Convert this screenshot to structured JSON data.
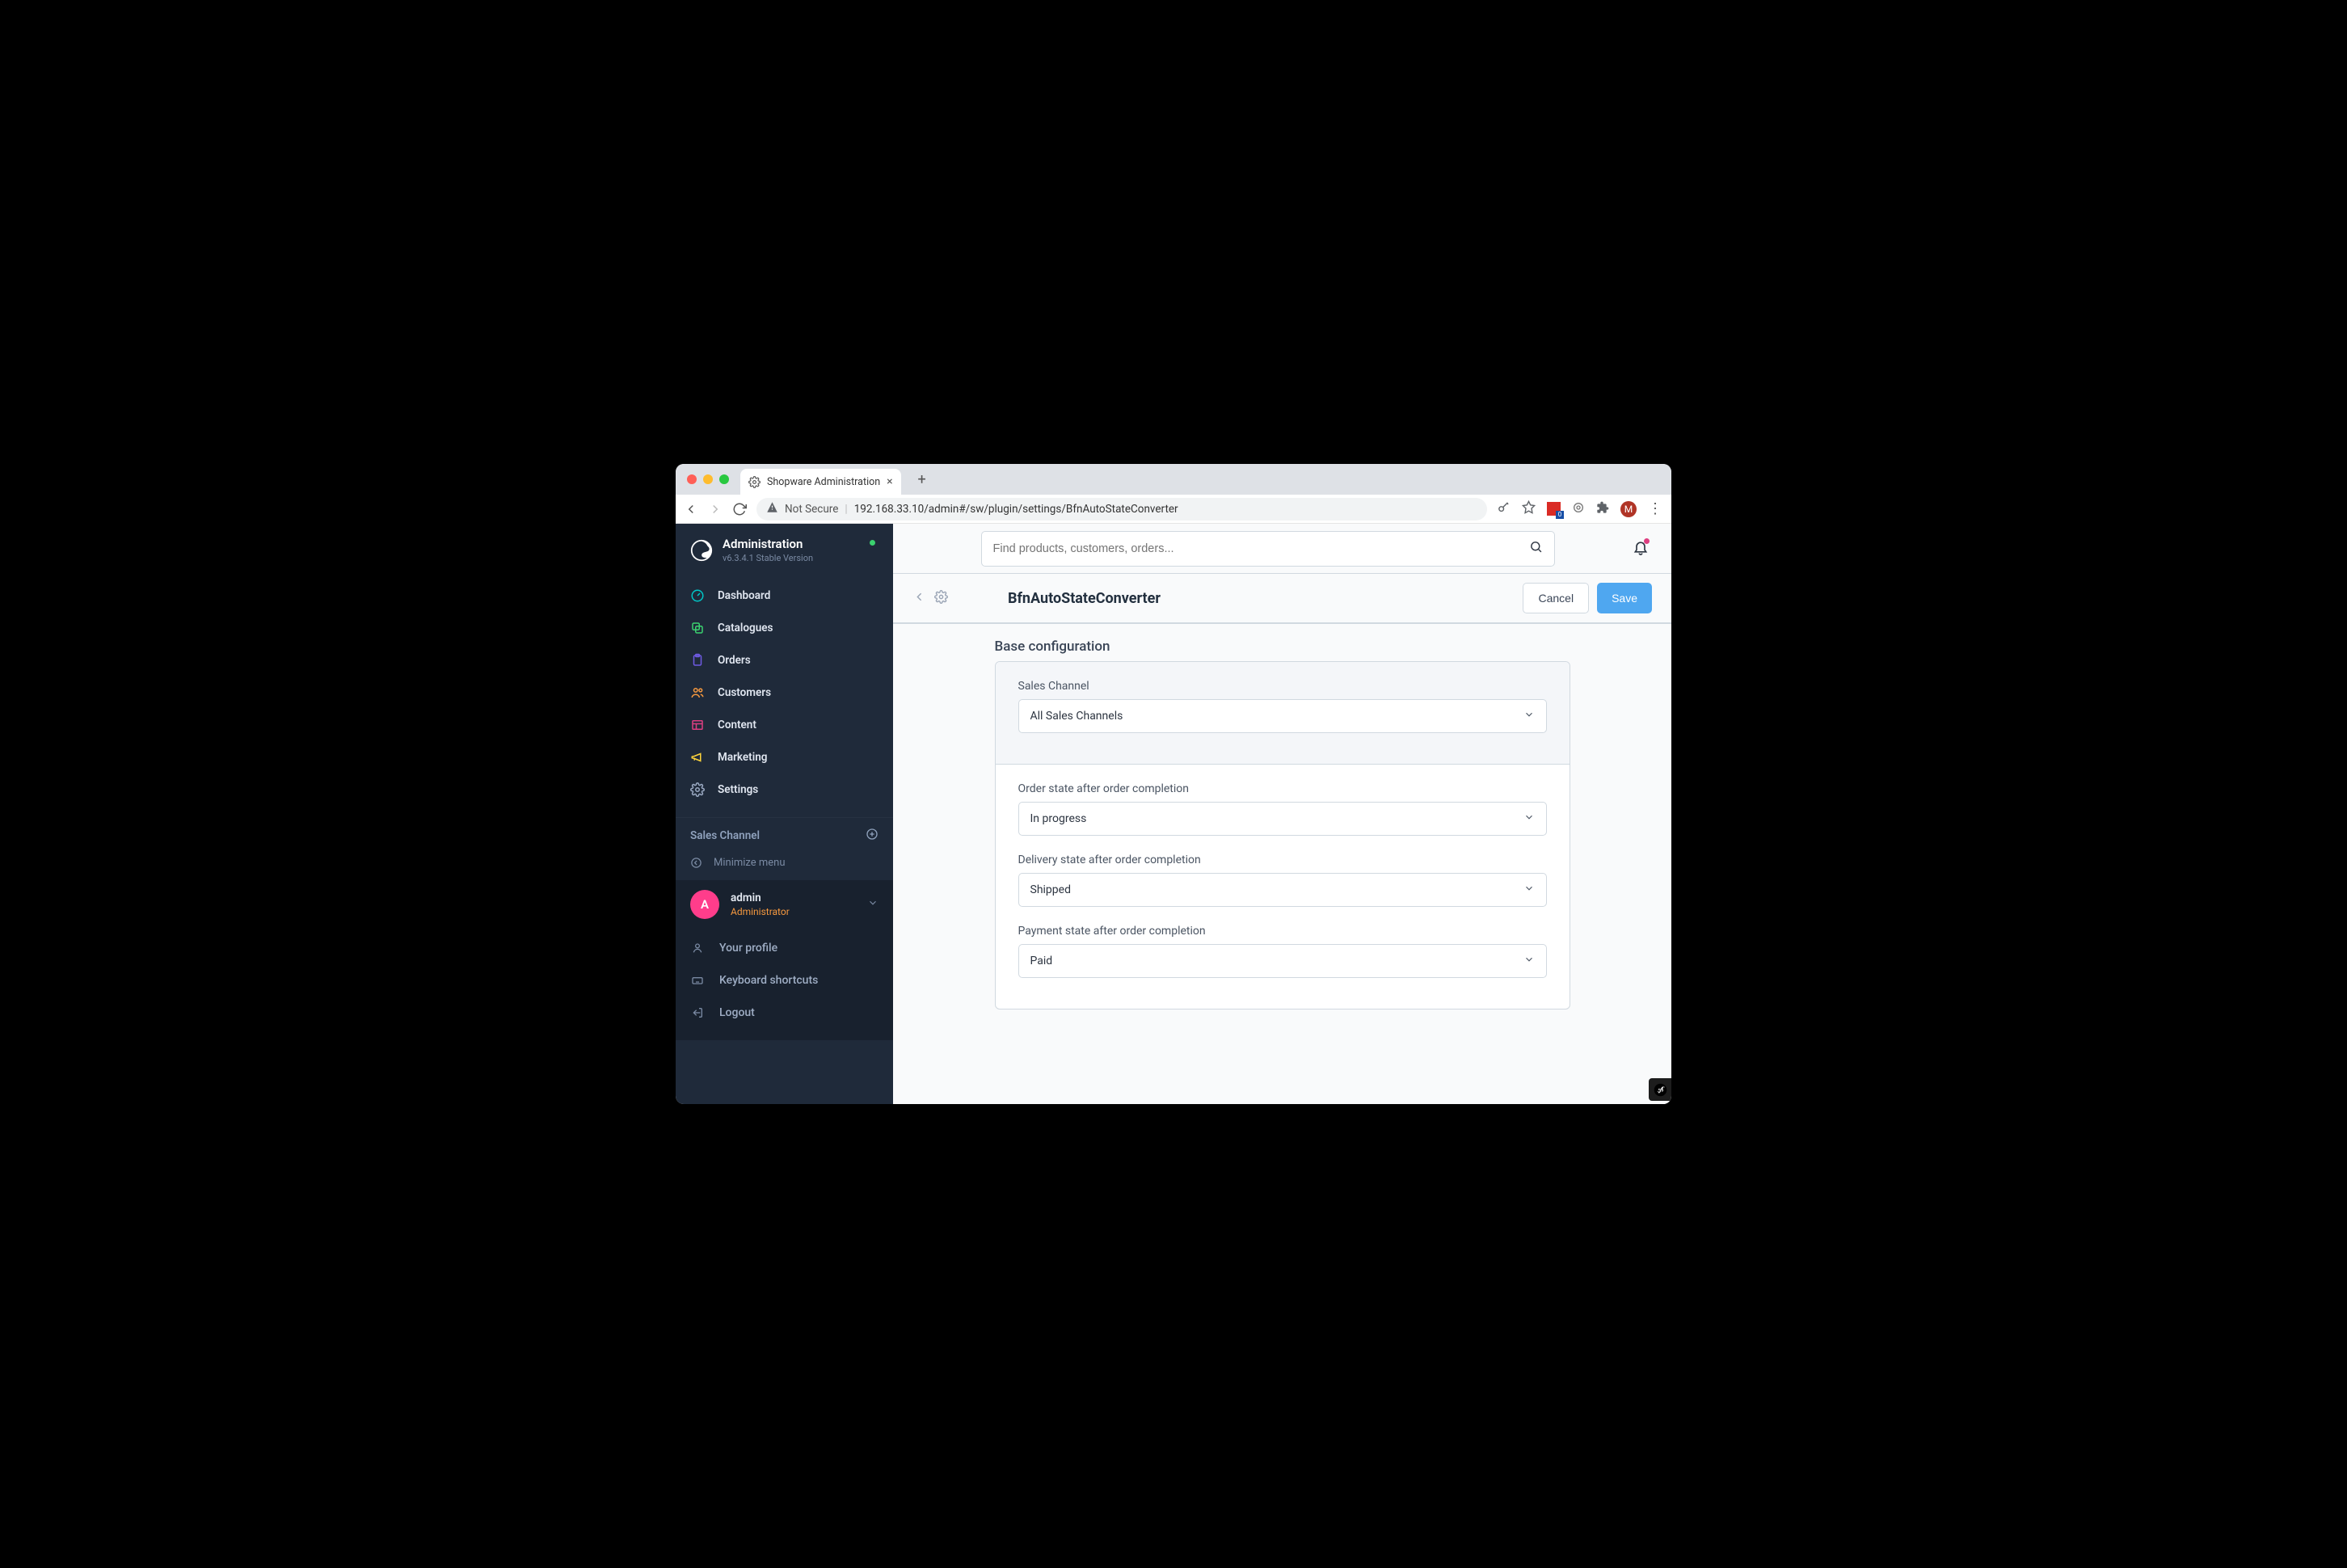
{
  "browser": {
    "tab_title": "Shopware Administration",
    "not_secure": "Not Secure",
    "url": "192.168.33.10/admin#/sw/plugin/settings/BfnAutoStateConverter",
    "avatar_letter": "M"
  },
  "sidebar": {
    "title": "Administration",
    "version": "v6.3.4.1 Stable Version",
    "nav": [
      {
        "label": "Dashboard"
      },
      {
        "label": "Catalogues"
      },
      {
        "label": "Orders"
      },
      {
        "label": "Customers"
      },
      {
        "label": "Content"
      },
      {
        "label": "Marketing"
      },
      {
        "label": "Settings"
      }
    ],
    "sales_channel_label": "Sales Channel",
    "minimize_label": "Minimize menu",
    "user": {
      "avatar_letter": "A",
      "name": "admin",
      "role": "Administrator"
    },
    "bottom": [
      {
        "label": "Your profile"
      },
      {
        "label": "Keyboard shortcuts"
      },
      {
        "label": "Logout"
      }
    ]
  },
  "main": {
    "search_placeholder": "Find products, customers, orders...",
    "page_title": "BfnAutoStateConverter",
    "cancel_label": "Cancel",
    "save_label": "Save",
    "section_title": "Base configuration",
    "fields": {
      "sales_channel": {
        "label": "Sales Channel",
        "value": "All Sales Channels"
      },
      "order_state": {
        "label": "Order state after order completion",
        "value": "In progress"
      },
      "delivery_state": {
        "label": "Delivery state after order completion",
        "value": "Shipped"
      },
      "payment_state": {
        "label": "Payment state after order completion",
        "value": "Paid"
      }
    }
  }
}
